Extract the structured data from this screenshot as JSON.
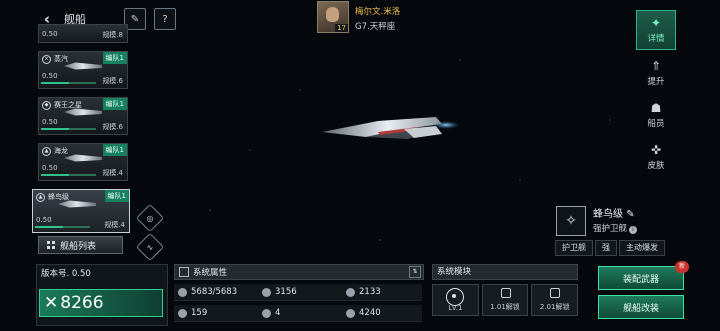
{
  "header": {
    "back_icon": "chevron-left-icon",
    "title": "舰船",
    "paint_icon": "paint-icon",
    "help_icon": "help-icon",
    "help_glyph": "?"
  },
  "captain": {
    "name": "梅尔文.米洛",
    "location": "G7.天秤座",
    "level": "17"
  },
  "ships": [
    {
      "name": "",
      "fleet": "",
      "pct": "0.50",
      "scale": "规模.8",
      "progress": 0.5
    },
    {
      "name": "蒸汽",
      "fleet": "编队1",
      "pct": "0.50",
      "scale": "规模.6",
      "progress": 0.5
    },
    {
      "name": "赛王之星",
      "fleet": "编队1",
      "pct": "0.50",
      "scale": "规模.6",
      "progress": 0.5
    },
    {
      "name": "海龙",
      "fleet": "编队1",
      "pct": "0.50",
      "scale": "规模.4",
      "progress": 0.5
    },
    {
      "name": "蜂鸟级",
      "fleet": "编队1",
      "pct": "0.50",
      "scale": "规模.4",
      "progress": 0.5
    }
  ],
  "list_button": "舰船列表",
  "side_tabs": [
    {
      "label": "详情",
      "active": true
    },
    {
      "label": "提升",
      "active": false
    },
    {
      "label": "船员",
      "active": false
    },
    {
      "label": "皮肤",
      "active": false
    }
  ],
  "ship_info": {
    "name": "蜂鸟级",
    "class": "强护卫舰",
    "tags": [
      "护卫舰",
      "强",
      "主动爆发"
    ]
  },
  "version": {
    "label": "版本号. 0.50",
    "power": "8266"
  },
  "attributes": {
    "title": "系统属性",
    "values": [
      "5683/5683",
      "3156",
      "2133",
      "159",
      "4",
      "4240"
    ]
  },
  "modules": {
    "title": "系统模块",
    "slots": [
      "Lv.1",
      "1.01解锁",
      "2.01解锁"
    ]
  },
  "actions": {
    "equip": "装配武器",
    "new_badge": "新",
    "refit": "舰船改装"
  },
  "colors": {
    "accent": "#2fc38a",
    "highlight": "#f1c04c"
  }
}
